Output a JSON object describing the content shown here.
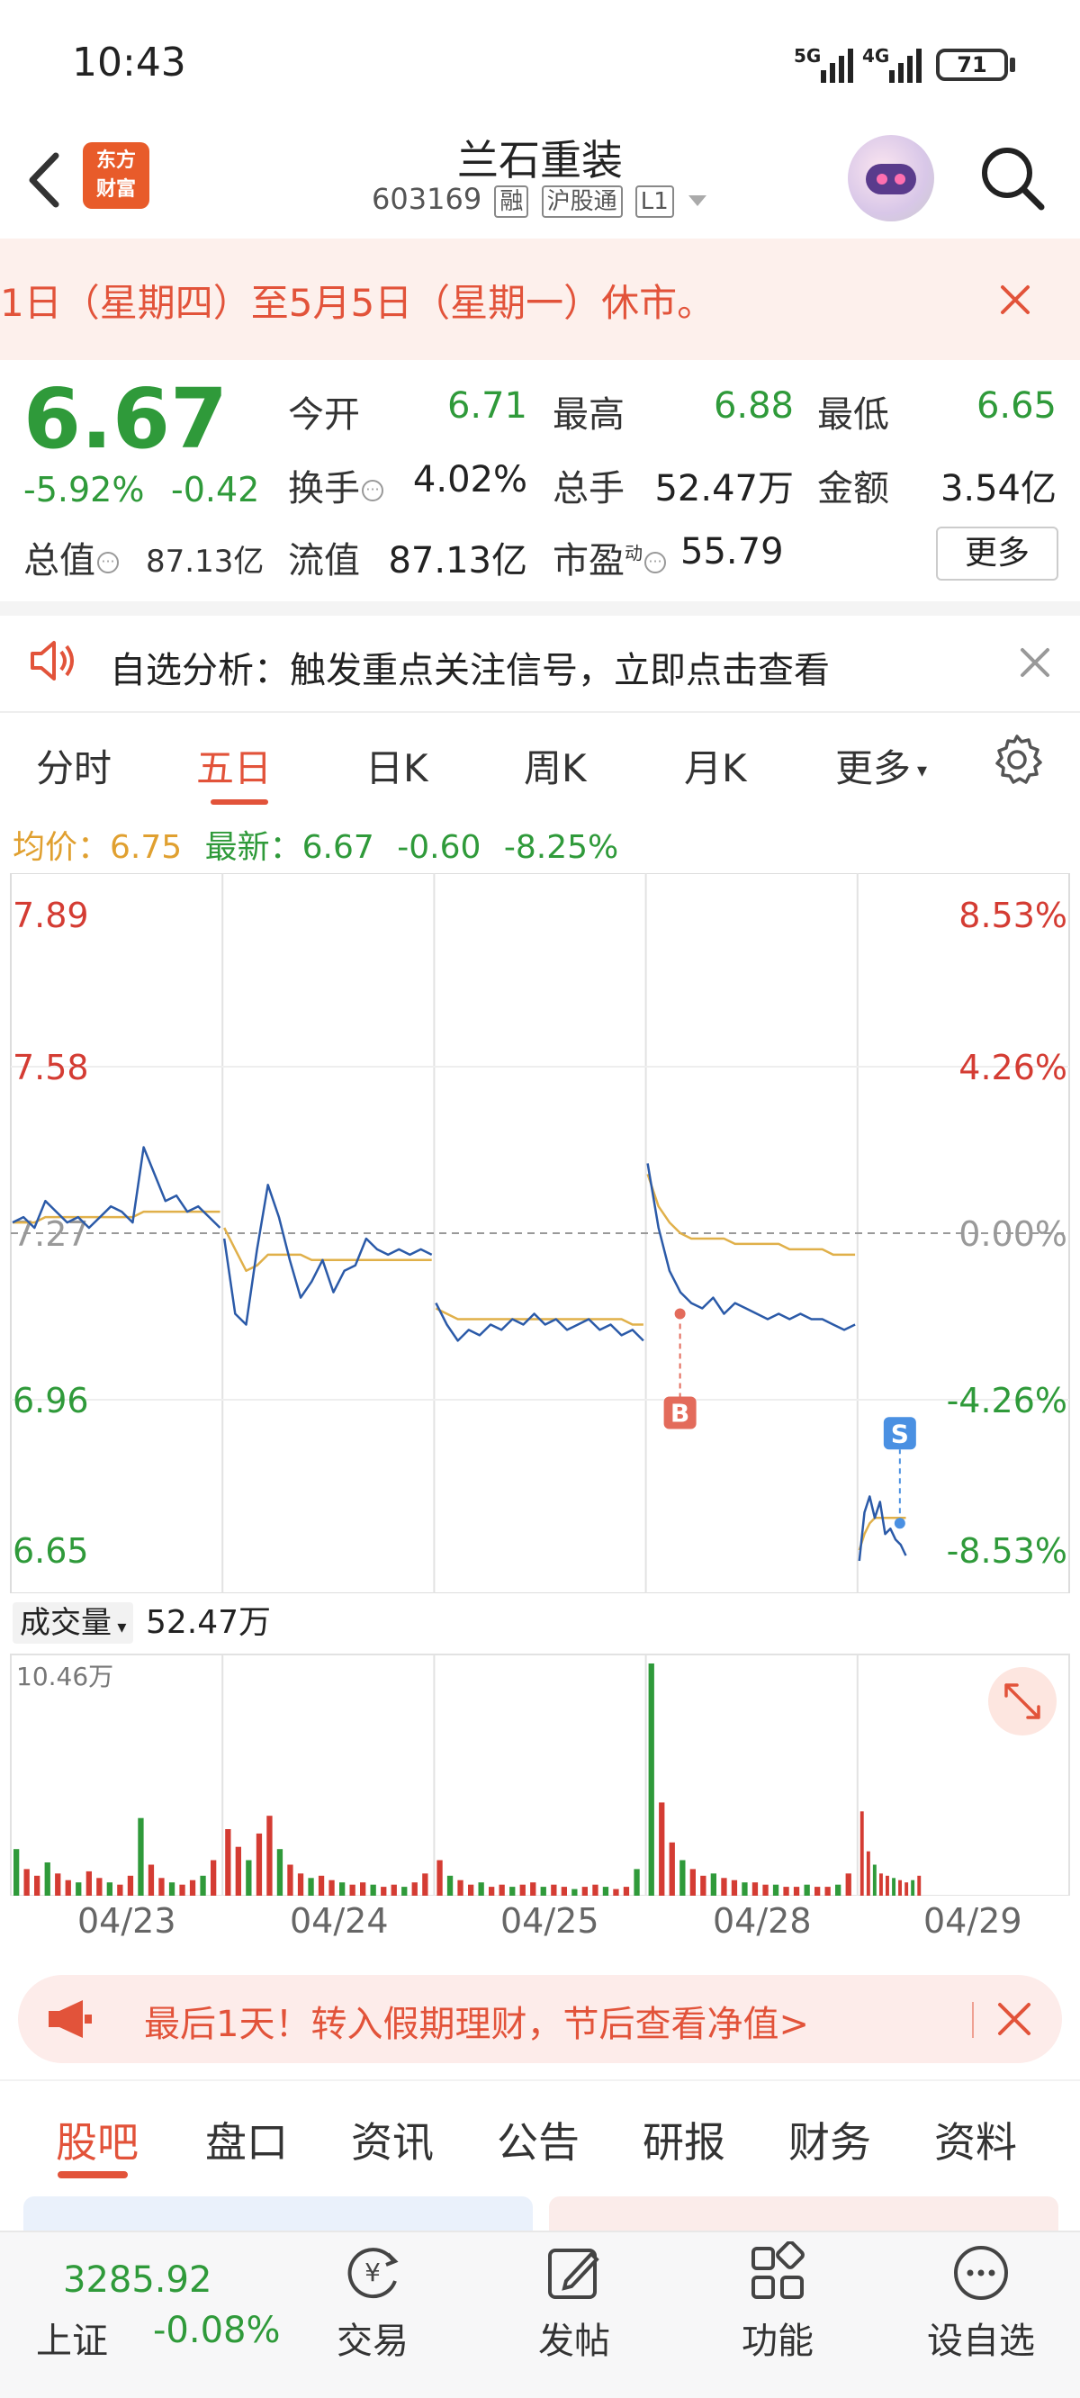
{
  "status": {
    "time": "10:43",
    "net1": "5G",
    "net2": "4G",
    "battery": "71"
  },
  "header": {
    "logo_text_line1": "东方",
    "logo_text_line2": "财富",
    "stock_name": "兰石重装",
    "stock_code": "603169",
    "tags": [
      "融",
      "沪股通",
      "L1"
    ]
  },
  "notice": {
    "text": "1日（星期四）至5月5日（星期一）休市。"
  },
  "quote": {
    "price": "6.67",
    "pct": "-5.92%",
    "change": "-0.42",
    "mktcap_label": "总值",
    "mktcap_value": "87.13亿",
    "rows": [
      [
        {
          "label": "今开",
          "value": "6.71",
          "color": "green"
        },
        {
          "label": "最高",
          "value": "6.88",
          "color": "green"
        },
        {
          "label": "最低",
          "value": "6.65",
          "color": "green"
        }
      ],
      [
        {
          "label": "换手",
          "value": "4.02%",
          "color": "dark"
        },
        {
          "label": "总手",
          "value": "52.47万",
          "color": "dark"
        },
        {
          "label": "金额",
          "value": "3.54亿",
          "color": "dark"
        }
      ],
      [
        {
          "label": "流值",
          "value": "87.13亿",
          "color": "dark"
        },
        {
          "label": "市盈",
          "value": "55.79",
          "color": "dark"
        }
      ]
    ],
    "pe_superscript": "动",
    "more": "更多"
  },
  "analysis": {
    "text": "自选分析：触发重点关注信号，立即点击查看"
  },
  "chart_tabs": [
    "分时",
    "五日",
    "日K",
    "周K",
    "月K",
    "更多"
  ],
  "chart_tab_active": 1,
  "avg_row": {
    "avg_label": "均价：",
    "avg_value": "6.75",
    "last_label": "最新：",
    "last_value": "6.67",
    "chg": "-0.60",
    "pct": "-8.25%"
  },
  "volume": {
    "label": "成交量",
    "total": "52.47万",
    "max_label": "10.46万"
  },
  "chart_data": {
    "type": "line",
    "title": "",
    "x_days": [
      "04/23",
      "04/24",
      "04/25",
      "04/28",
      "04/29"
    ],
    "y_left_ticks": [
      "7.89",
      "7.58",
      "7.27",
      "6.96",
      "6.65"
    ],
    "y_right_ticks": [
      "8.53%",
      "4.26%",
      "0.00%",
      "-4.26%",
      "-8.53%"
    ],
    "ylim": [
      6.65,
      7.89
    ],
    "reference_close": 7.27,
    "markers": [
      {
        "label": "B",
        "day": "04/28",
        "price": 7.12
      },
      {
        "label": "S",
        "day": "04/29",
        "price": 6.73
      }
    ],
    "series": [
      {
        "name": "最新",
        "color": "#2b5aa8",
        "days": [
          [
            7.29,
            7.3,
            7.28,
            7.33,
            7.31,
            7.29,
            7.3,
            7.28,
            7.3,
            7.32,
            7.31,
            7.29,
            7.43,
            7.38,
            7.33,
            7.34,
            7.31,
            7.32,
            7.3,
            7.28
          ],
          [
            7.26,
            7.12,
            7.1,
            7.24,
            7.36,
            7.3,
            7.22,
            7.15,
            7.18,
            7.22,
            7.16,
            7.2,
            7.21,
            7.26,
            7.24,
            7.23,
            7.24,
            7.23,
            7.24,
            7.23
          ],
          [
            7.14,
            7.1,
            7.07,
            7.09,
            7.08,
            7.1,
            7.09,
            7.11,
            7.1,
            7.12,
            7.1,
            7.11,
            7.09,
            7.1,
            7.11,
            7.09,
            7.1,
            7.08,
            7.09,
            7.07
          ],
          [
            7.4,
            7.28,
            7.2,
            7.16,
            7.14,
            7.13,
            7.15,
            7.12,
            7.14,
            7.13,
            7.12,
            7.11,
            7.12,
            7.11,
            7.12,
            7.11,
            7.11,
            7.1,
            7.09,
            7.1
          ],
          [
            6.66,
            6.75,
            6.78,
            6.74,
            6.77,
            6.71,
            6.72,
            6.7,
            6.69,
            6.67
          ]
        ]
      },
      {
        "name": "均价",
        "color": "#e0b04a",
        "days": [
          [
            7.29,
            7.29,
            7.29,
            7.3,
            7.3,
            7.3,
            7.3,
            7.3,
            7.3,
            7.3,
            7.3,
            7.3,
            7.31,
            7.31,
            7.31,
            7.31,
            7.31,
            7.31,
            7.31,
            7.31
          ],
          [
            7.28,
            7.24,
            7.2,
            7.21,
            7.23,
            7.23,
            7.23,
            7.23,
            7.22,
            7.22,
            7.22,
            7.22,
            7.22,
            7.22,
            7.22,
            7.22,
            7.22,
            7.22,
            7.22,
            7.22
          ],
          [
            7.13,
            7.12,
            7.11,
            7.11,
            7.11,
            7.11,
            7.11,
            7.11,
            7.11,
            7.11,
            7.11,
            7.11,
            7.11,
            7.11,
            7.11,
            7.11,
            7.11,
            7.11,
            7.1,
            7.1
          ],
          [
            7.38,
            7.32,
            7.29,
            7.27,
            7.26,
            7.26,
            7.26,
            7.26,
            7.25,
            7.25,
            7.25,
            7.25,
            7.25,
            7.24,
            7.24,
            7.24,
            7.24,
            7.23,
            7.23,
            7.23
          ],
          [
            6.68,
            6.71,
            6.73,
            6.74,
            6.74,
            6.74,
            6.74,
            6.74,
            6.74,
            6.74
          ]
        ]
      }
    ]
  },
  "volume_data": {
    "max": 10.46,
    "days": [
      [
        2.1,
        1.2,
        0.9,
        1.5,
        1.0,
        0.7,
        0.6,
        1.1,
        0.8,
        0.6,
        0.5,
        0.9,
        3.5,
        1.4,
        0.8,
        0.6,
        0.5,
        0.7,
        0.9,
        1.6
      ],
      [
        3.0,
        2.2,
        1.6,
        2.8,
        3.6,
        2.1,
        1.4,
        1.0,
        0.8,
        0.9,
        0.7,
        0.6,
        0.5,
        0.6,
        0.5,
        0.4,
        0.5,
        0.4,
        0.6,
        1.0
      ],
      [
        1.6,
        0.9,
        0.7,
        0.5,
        0.6,
        0.4,
        0.5,
        0.4,
        0.5,
        0.6,
        0.4,
        0.5,
        0.4,
        0.3,
        0.4,
        0.5,
        0.4,
        0.3,
        0.4,
        1.2
      ],
      [
        10.46,
        4.2,
        2.4,
        1.6,
        1.2,
        0.9,
        1.0,
        0.8,
        0.7,
        0.6,
        0.6,
        0.5,
        0.5,
        0.4,
        0.4,
        0.5,
        0.4,
        0.4,
        0.5,
        1.0
      ],
      [
        3.8,
        2.0,
        1.4,
        1.0,
        0.9,
        0.8,
        0.7,
        0.6,
        0.7,
        0.9
      ]
    ]
  },
  "promo": {
    "text": "最后1天！转入假期理财，节后查看净值>"
  },
  "section_tabs": [
    "股吧",
    "盘口",
    "资讯",
    "公告",
    "研报",
    "财务",
    "资料"
  ],
  "section_tab_active": 0,
  "bottom_nav": {
    "index_value": "3285.92",
    "index_name": "上证",
    "index_change": "-0.08%",
    "items": [
      "交易",
      "发帖",
      "功能",
      "设自选"
    ]
  },
  "colors": {
    "up": "#d43c33",
    "down": "#2f9a3a",
    "accent": "#e2533a",
    "price_line": "#2b5aa8",
    "avg_line": "#e0b04a"
  }
}
